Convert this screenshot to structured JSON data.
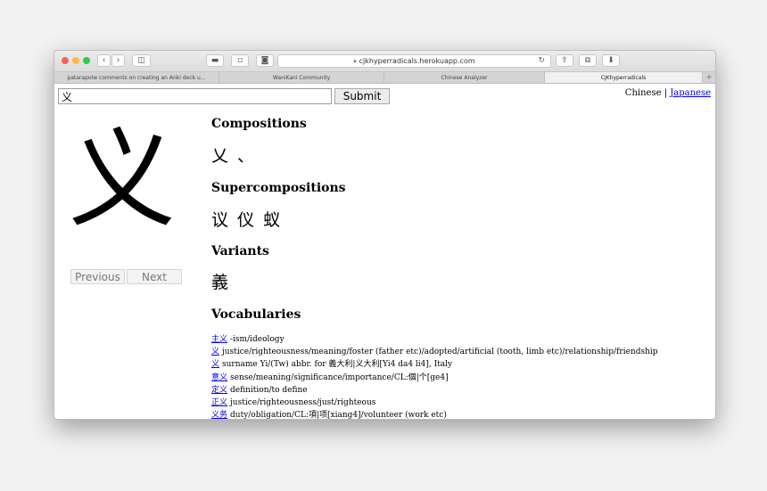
{
  "browser": {
    "url": "cjkhyperradicals.herokuapp.com",
    "tabs": [
      {
        "label": "patarapolw comments on creating an Anki deck u..."
      },
      {
        "label": "WaniKani Community"
      },
      {
        "label": "Chinese Analyzer"
      },
      {
        "label": "CJKhyperradicals"
      }
    ]
  },
  "search": {
    "value": "义",
    "submit_label": "Submit"
  },
  "lang": {
    "chinese": "Chinese",
    "separator": "|",
    "japanese": "Japanese"
  },
  "character": "义",
  "nav": {
    "previous": "Previous",
    "next": "Next"
  },
  "sections": {
    "compositions": {
      "title": "Compositions",
      "chars": "乂 、"
    },
    "supercompositions": {
      "title": "Supercompositions",
      "chars": "议 仪 蚁"
    },
    "variants": {
      "title": "Variants",
      "chars": "義"
    },
    "vocabularies": {
      "title": "Vocabularies"
    }
  },
  "vocabularies": [
    {
      "word": "主义",
      "definition": "-ism/ideology"
    },
    {
      "word": "义",
      "definition": "justice/righteousness/meaning/foster (father etc)/adopted/artificial (tooth, limb etc)/relationship/friendship"
    },
    {
      "word": "义",
      "definition": "surname Yi/(Tw) abbr. for 義大利|义大利[Yi4 da4 li4], Italy"
    },
    {
      "word": "意义",
      "definition": "sense/meaning/significance/importance/CL:個|个[ge4]"
    },
    {
      "word": "定义",
      "definition": "definition/to define"
    },
    {
      "word": "正义",
      "definition": "justice/righteousness/just/righteous"
    },
    {
      "word": "义务",
      "definition": "duty/obligation/CL:項|项[xiang4]/volunteer (work etc)"
    }
  ]
}
